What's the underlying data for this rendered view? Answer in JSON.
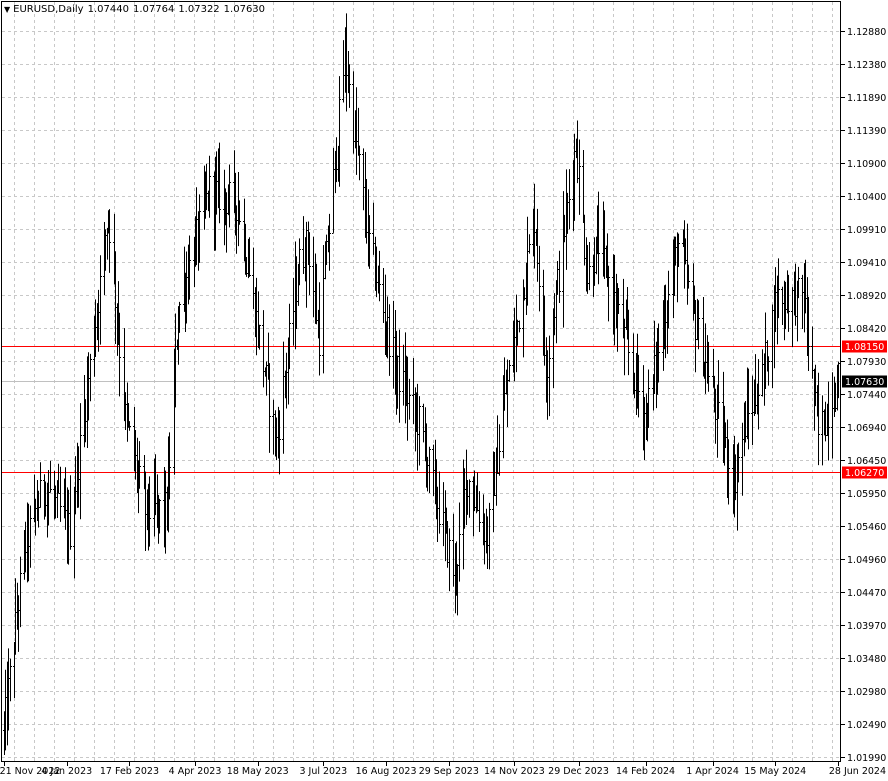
{
  "header": {
    "symbol_timeframe": "EURUSD,Daily",
    "open": "1.07440",
    "high": "1.07764",
    "low": "1.07322",
    "close": "1.07630"
  },
  "colors": {
    "background": "#ffffff",
    "grid": "#c8c8c8",
    "bars": "#000000",
    "level_line": "#ff0000",
    "level_tag_bg": "#ff0000",
    "level_tag_text": "#ffffff",
    "price_tag_bg": "#000000",
    "price_tag_text": "#ffffff",
    "bid_line": "#c0c0c0"
  },
  "chart_data": {
    "type": "ohlc",
    "grid": true,
    "y_ticks": [
      "1.12880",
      "1.12380",
      "1.11890",
      "1.11390",
      "1.10900",
      "1.10400",
      "1.09910",
      "1.09410",
      "1.08920",
      "1.08420",
      "1.07930",
      "1.07440",
      "1.06940",
      "1.06450",
      "1.05950",
      "1.05460",
      "1.04960",
      "1.04470",
      "1.03970",
      "1.03480",
      "1.02980",
      "1.02490",
      "1.01990"
    ],
    "ylim": [
      1.0199,
      1.1288
    ],
    "x_ticks": [
      "21 Nov 2022",
      "4 Jan 2023",
      "17 Feb 2023",
      "4 Apr 2023",
      "18 May 2023",
      "3 Jul 2023",
      "16 Aug 2023",
      "29 Sep 2023",
      "14 Nov 2023",
      "29 Dec 2023",
      "14 Feb 2024",
      "1 Apr 2024",
      "15 May 2024",
      "28 Jun 2024"
    ],
    "xlim": [
      "2022-11-21",
      "2024-06-28"
    ],
    "horizontal_levels": [
      {
        "price": 1.0815,
        "label": "1.08150"
      },
      {
        "price": 1.0627,
        "label": "1.06270"
      }
    ],
    "current_price": {
      "price": 1.0763,
      "label": "1.07630"
    },
    "price_path": [
      [
        "2022-11-21",
        1.024
      ],
      [
        "2022-12-05",
        1.051
      ],
      [
        "2022-12-19",
        1.061
      ],
      [
        "2023-01-06",
        1.054
      ],
      [
        "2023-01-26",
        1.089
      ],
      [
        "2023-02-02",
        1.102
      ],
      [
        "2023-02-14",
        1.071
      ],
      [
        "2023-02-28",
        1.057
      ],
      [
        "2023-03-15",
        1.057
      ],
      [
        "2023-03-23",
        1.087
      ],
      [
        "2023-04-14",
        1.105
      ],
      [
        "2023-05-04",
        1.103
      ],
      [
        "2023-05-31",
        1.067
      ],
      [
        "2023-06-16",
        1.094
      ],
      [
        "2023-06-22",
        1.097
      ],
      [
        "2023-06-30",
        1.083
      ],
      [
        "2023-07-18",
        1.125
      ],
      [
        "2023-08-04",
        1.097
      ],
      [
        "2023-08-23",
        1.078
      ],
      [
        "2023-09-08",
        1.07
      ],
      [
        "2023-10-03",
        1.047
      ],
      [
        "2023-10-12",
        1.062
      ],
      [
        "2023-10-26",
        1.053
      ],
      [
        "2023-11-06",
        1.072
      ],
      [
        "2023-11-28",
        1.101
      ],
      [
        "2023-12-06",
        1.078
      ],
      [
        "2023-12-27",
        1.112
      ],
      [
        "2024-01-04",
        1.092
      ],
      [
        "2024-01-12",
        1.097
      ],
      [
        "2024-02-14",
        1.071
      ],
      [
        "2024-03-08",
        1.097
      ],
      [
        "2024-03-19",
        1.086
      ],
      [
        "2024-04-01",
        1.074
      ],
      [
        "2024-04-16",
        1.061
      ],
      [
        "2024-04-24",
        1.07
      ],
      [
        "2024-05-06",
        1.077
      ],
      [
        "2024-05-16",
        1.089
      ],
      [
        "2024-06-04",
        1.089
      ],
      [
        "2024-06-14",
        1.068
      ],
      [
        "2024-06-28",
        1.0763
      ]
    ]
  }
}
